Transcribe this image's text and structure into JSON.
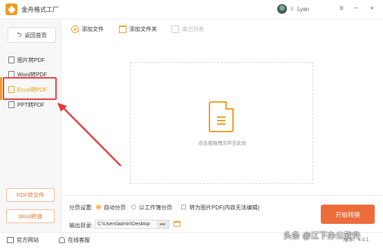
{
  "app": {
    "title": "金舟格式工厂",
    "user": "Lyan",
    "vip_icon": "crown-icon"
  },
  "sidebar": {
    "home_label": "返回首页",
    "items": [
      {
        "label": "图片转PDF"
      },
      {
        "label": "Word转PDF"
      },
      {
        "label": "Excel转PDF"
      },
      {
        "label": "PPT转PDF"
      }
    ],
    "buttons": [
      {
        "label": "PDF转文件"
      },
      {
        "label": "Word转换"
      }
    ]
  },
  "toolbar": {
    "add_file": "添加文件",
    "add_folder": "添加文件夹",
    "clear_list": "清空列表"
  },
  "dropzone": {
    "hint": "点击或拖拽文件至此处"
  },
  "settings": {
    "pagination_label": "分页设置:",
    "auto_page": "自动分页",
    "sheet_page": "以工作簿分页",
    "to_image": "转为图片PDF",
    "to_image_note": "(内容无法编辑)",
    "output_label": "输出目录:",
    "output_path": "C:\\Users\\admin\\Desktop",
    "browse": "•••",
    "start": "开始转换"
  },
  "footer": {
    "website": "官方网站",
    "support": "在线客服",
    "version": "版本：4.0.1"
  },
  "watermark": "头条 @江下办公软件",
  "colors": {
    "accent": "#f19a21",
    "start_button": "#ec6d3b",
    "highlight": "#e8393b"
  }
}
